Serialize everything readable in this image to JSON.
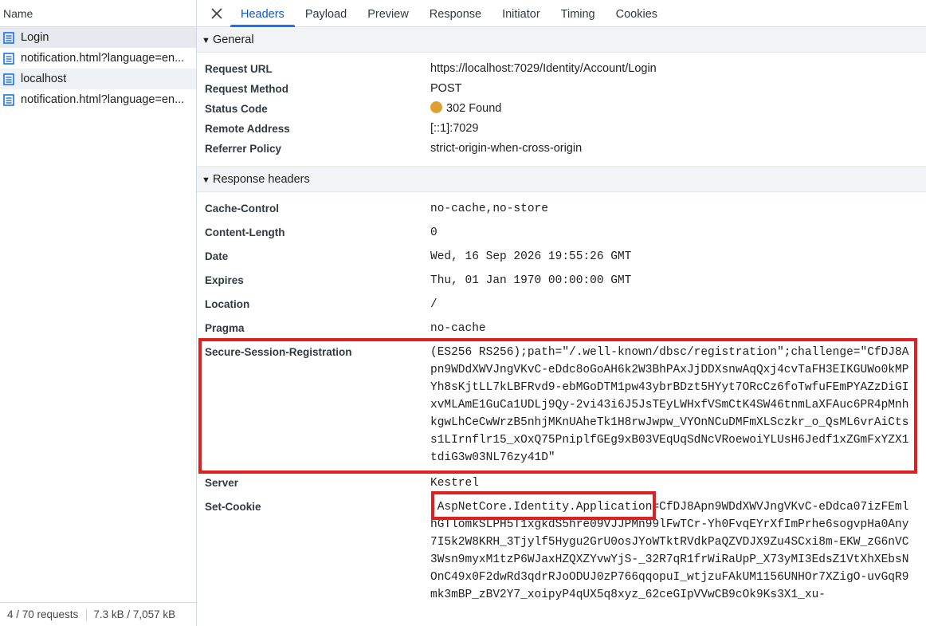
{
  "request_list": {
    "column_header": "Name",
    "items": [
      {
        "label": "Login"
      },
      {
        "label": "notification.html?language=en..."
      },
      {
        "label": "localhost"
      },
      {
        "label": "notification.html?language=en..."
      }
    ],
    "footer": {
      "requests": "4 / 70 requests",
      "size": "7.3 kB / 7,057 kB"
    }
  },
  "tabs": {
    "close_icon": "close-icon",
    "items": [
      {
        "label": "Headers"
      },
      {
        "label": "Payload"
      },
      {
        "label": "Preview"
      },
      {
        "label": "Response"
      },
      {
        "label": "Initiator"
      },
      {
        "label": "Timing"
      },
      {
        "label": "Cookies"
      }
    ],
    "active": "Headers"
  },
  "general": {
    "title": "General",
    "rows": [
      {
        "key": "Request URL",
        "value": "https://localhost:7029/Identity/Account/Login"
      },
      {
        "key": "Request Method",
        "value": "POST"
      },
      {
        "key": "Status Code",
        "value": "302 Found"
      },
      {
        "key": "Remote Address",
        "value": "[::1]:7029"
      },
      {
        "key": "Referrer Policy",
        "value": "strict-origin-when-cross-origin"
      }
    ]
  },
  "response_headers": {
    "title": "Response headers",
    "rows": [
      {
        "key": "Cache-Control",
        "value": "no-cache,no-store"
      },
      {
        "key": "Content-Length",
        "value": "0"
      },
      {
        "key": "Date",
        "value": "Wed, 16 Sep 2026 19:55:26 GMT"
      },
      {
        "key": "Expires",
        "value": "Thu, 01 Jan 1970 00:00:00 GMT"
      },
      {
        "key": "Location",
        "value": "/"
      },
      {
        "key": "Pragma",
        "value": "no-cache"
      },
      {
        "key": "Secure-Session-Registration",
        "value": "(ES256 RS256);path=\"/.well-known/dbsc/registration\";challenge=\"CfDJ8Apn9WDdXWVJngVKvC-eDdc8oGoAH6k2W3BhPAxJjDDXsnwAqQxj4cvTaFH3EIKGUWo0kMPYh8sKjtLL7kLBFRvd9-ebMGoDTM1pw43ybrBDzt5HYyt7ORcCz6foTwfuFEmPYAZzDiGIxvMLAmE1GuCa1UDLj9Qy-2vi43i6J5JsTEyLWHxfVSmCtK4SW46tnmLaXFAuc6PR4pMnhkgwLhCeCwWrzB5nhjMKnUAheTk1H8rwJwpw_VYOnNCuDMFmXLSczkr_o_QsML6vrAiCtss1LIrnflr15_xOxQ75PniplfGEg9xB03VEqUqSdNcVRoewoiYLUsH6Jedf1xZGmFxYZX1tdiG3w03NL76zy41D\""
      },
      {
        "key": "Server",
        "value": "Kestrel"
      },
      {
        "key": "Set-Cookie",
        "value": ".AspNetCore.Identity.Application=CfDJ8Apn9WDdXWVJngVKvC-eDdca07izFEmlhGTlomkSLPH5T1xgkdS5hre09VJJPMn99lFwTCr-Yh0FvqEYrXfImPrhe6sogvpHa0Any7I5k2W8KRH_3Tjylf5Hygu2GrU0osJYoWTktRVdkPaQZVDJX9Zu4SCxi8m-EKW_zG6nVC3Wsn9myxM1tzP6WJaxHZQXZYvwYjS-_32R7qR1frWiRaUpP_X73yMI3EdsZ1VtXhXEbsNOnC49x0F2dwRd3qdrRJoODUJ0zP766qqopuI_wtjzuFAkUM1156UNHOr7XZigO-uvGqR9mk3mBP_zBV2Y7_xoipyP4qUX5q8xyz_62ceGIpVVwCB9cOk9Ks3X1_xu-"
      }
    ]
  },
  "colors": {
    "highlight": "#e02020",
    "status_dot": "#e0a030",
    "active_tab": "#1a73e8"
  }
}
